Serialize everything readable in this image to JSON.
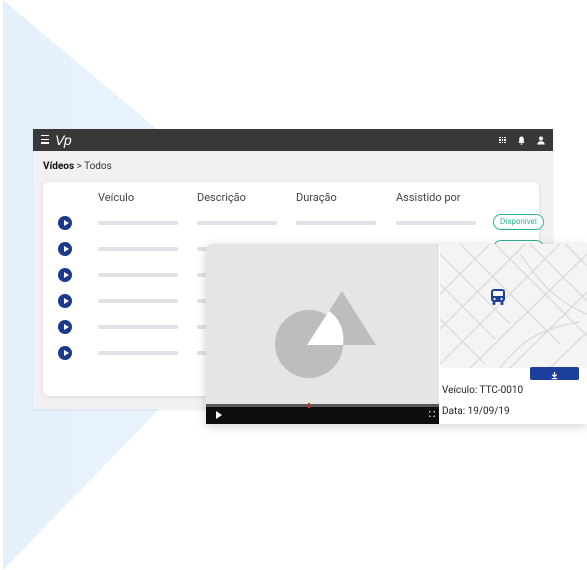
{
  "topbar": {
    "logo_text": "Vp",
    "menu_icon": "hamburger-menu-icon",
    "icons": [
      "apps-grid-icon",
      "bell-icon",
      "user-icon"
    ],
    "background": "#383838"
  },
  "breadcrumb": {
    "section": "Vídeos",
    "separator": ">",
    "current": "Todos"
  },
  "table": {
    "columns": [
      "Veículo",
      "Descrição",
      "Duração",
      "Assistido por"
    ],
    "status_label": "Disponível",
    "row_count": 6,
    "play_icon": "play-circle-icon",
    "status_color": "#2bb393",
    "play_color": "#1b3a8b"
  },
  "popup": {
    "vehicle_label": "Veículo: TTC-0010",
    "date_label": "Data: 19/09/19",
    "map_marker_icon": "bus-icon",
    "download_icon": "download-icon",
    "controls": [
      "play-icon",
      "fullscreen-icon"
    ],
    "accent": "#1b3f9a"
  },
  "background_colors": {
    "panel": "#e9f3fc",
    "card": "#ffffff"
  }
}
